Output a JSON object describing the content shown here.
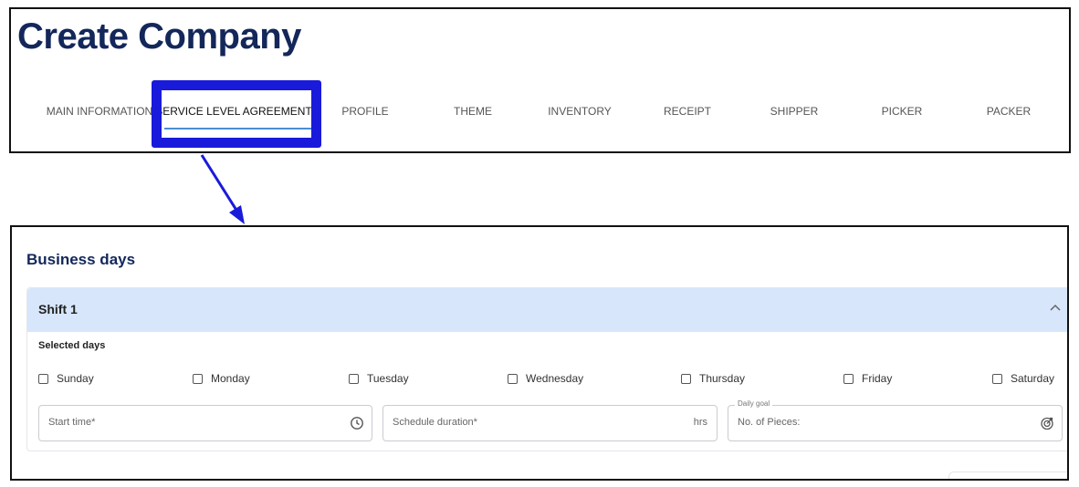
{
  "page": {
    "title": "Create Company"
  },
  "tabs": [
    {
      "label": "MAIN INFORMATION"
    },
    {
      "label": "SERVICE LEVEL AGREEMENT",
      "active": true
    },
    {
      "label": "PROFILE"
    },
    {
      "label": "THEME"
    },
    {
      "label": "INVENTORY"
    },
    {
      "label": "RECEIPT"
    },
    {
      "label": "SHIPPER"
    },
    {
      "label": "PICKER"
    },
    {
      "label": "PACKER"
    }
  ],
  "business_days": {
    "title": "Business days",
    "shift": {
      "title": "Shift 1",
      "expanded": true,
      "selected_days_label": "Selected days",
      "days": [
        {
          "label": "Sunday",
          "checked": false
        },
        {
          "label": "Monday",
          "checked": false
        },
        {
          "label": "Tuesday",
          "checked": false
        },
        {
          "label": "Wednesday",
          "checked": false
        },
        {
          "label": "Thursday",
          "checked": false
        },
        {
          "label": "Friday",
          "checked": false
        },
        {
          "label": "Saturday",
          "checked": false
        }
      ],
      "fields": {
        "start_time": {
          "placeholder": "Start time*",
          "icon": "clock-icon"
        },
        "schedule_duration": {
          "placeholder": "Schedule duration*",
          "suffix": "hrs"
        },
        "daily_goal": {
          "legend": "Daily goal",
          "placeholder": "No. of Pieces:",
          "icon": "target-icon"
        }
      }
    }
  },
  "colors": {
    "title": "#13275a",
    "highlight": "#1a1adb",
    "tab_underline": "#4a8ed6",
    "shift_header_bg": "#d7e6fb"
  }
}
